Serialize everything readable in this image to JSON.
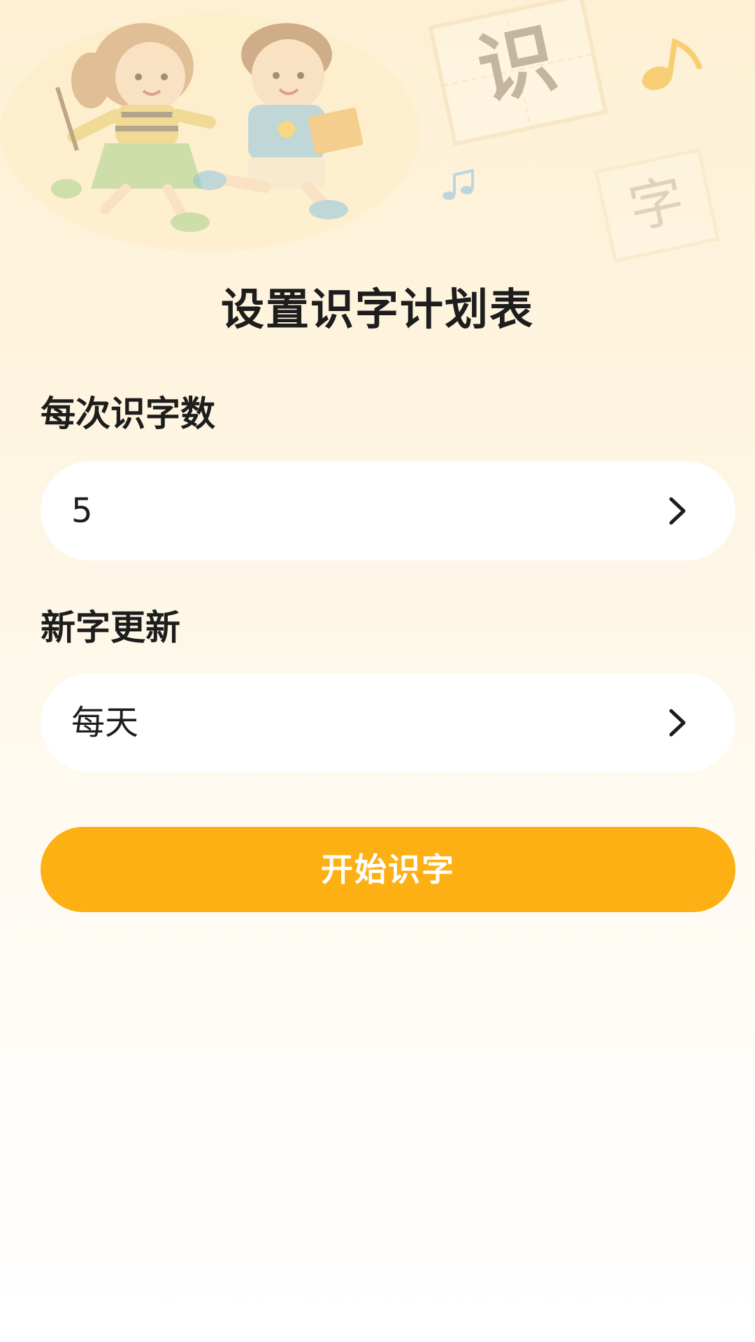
{
  "hero": {
    "character_1": "识",
    "character_2": "字"
  },
  "title": "设置识字计划表",
  "words_per_session": {
    "label": "每次识字数",
    "value": "5"
  },
  "new_word_update": {
    "label": "新字更新",
    "value": "每天"
  },
  "start_button": {
    "label": "开始识字"
  },
  "colors": {
    "accent": "#fdb014",
    "background_top": "#fdf0d4",
    "background_bottom": "#ffffff",
    "text": "#1d1d1d"
  }
}
